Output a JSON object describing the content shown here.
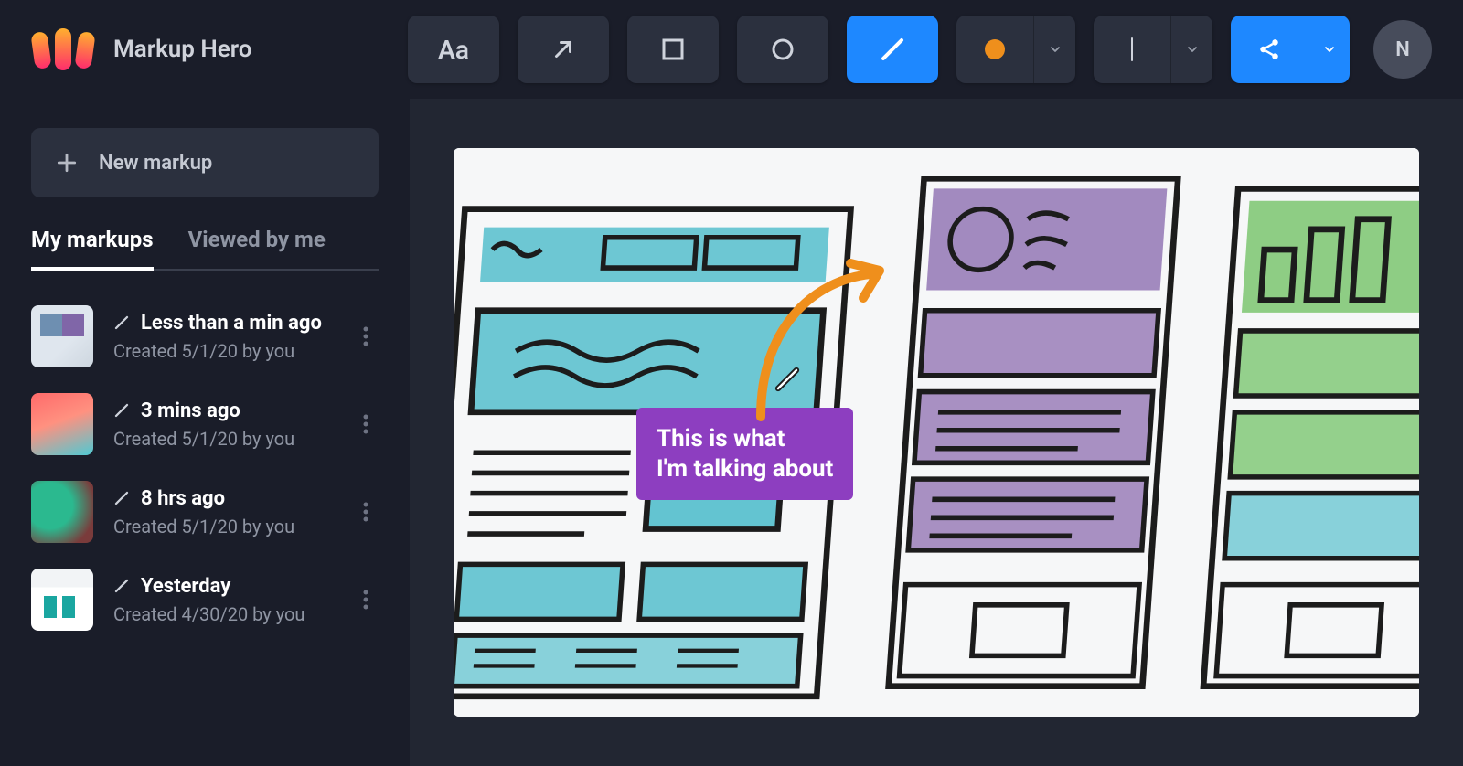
{
  "brand": {
    "name": "Markup Hero"
  },
  "avatar": {
    "initial": "N"
  },
  "toolbar": {
    "text_tool": "Aa",
    "arrow_tool": "arrow",
    "rect_tool": "rect",
    "oval_tool": "oval",
    "pen_tool": "pen",
    "color_tool": {
      "color": "#ef8f1c"
    },
    "stroke_tool": "|",
    "share_tool": "share"
  },
  "sidebar": {
    "new_markup_label": "New markup",
    "tabs": {
      "my_markups": "My markups",
      "viewed_by_me": "Viewed by me",
      "active": "my_markups"
    },
    "items": [
      {
        "title": "Less than a min ago",
        "subtitle": "Created 5/1/20 by you",
        "thumb": "a"
      },
      {
        "title": "3 mins ago",
        "subtitle": "Created 5/1/20 by you",
        "thumb": "b"
      },
      {
        "title": "8 hrs ago",
        "subtitle": "Created 5/1/20 by you",
        "thumb": "c"
      },
      {
        "title": "Yesterday",
        "subtitle": "Created 4/30/20 by you",
        "thumb": "d"
      }
    ]
  },
  "annotation": {
    "text": "This is what\nI'm talking about"
  }
}
